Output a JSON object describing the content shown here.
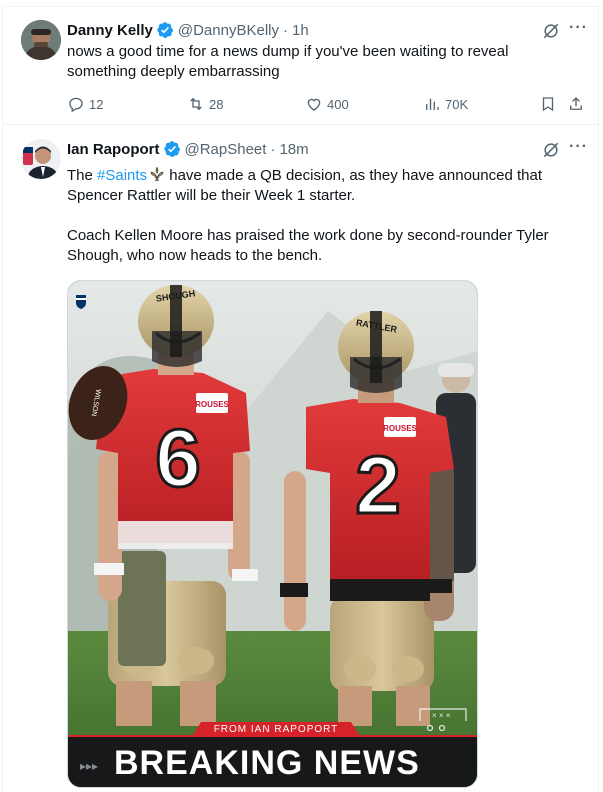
{
  "tweets": [
    {
      "name": "Danny Kelly",
      "handle": "@DannyBKelly",
      "time": "1h",
      "text": "nows a good time for a news dump if you've been waiting to reveal something deeply embarrassing",
      "replies": "12",
      "reposts": "28",
      "likes": "400",
      "views": "70K"
    },
    {
      "name": "Ian Rapoport",
      "handle": "@RapSheet",
      "time": "18m",
      "text_pre": "The ",
      "hashtag": "#Saints",
      "text_post": " have made a QB decision, as they have announced that Spencer Rattler will be their Week 1 starter.",
      "text2": "Coach Kellen Moore has praised the work done by second-rounder Tyler Shough, who now heads to the bench.",
      "media": {
        "helmet_left": "SHOUGH",
        "helmet_right": "RATTLER",
        "jersey_left": "6",
        "jersey_right": "2",
        "sponsor": "ROUSES",
        "ticker_top": "FROM IAN RAPOPORT",
        "ticker_main": "BREAKING NEWS",
        "ticker_arrows": "▸▸▸"
      }
    }
  ],
  "colors": {
    "link": "#1d9bf0",
    "muted": "#536471",
    "verified": "#1d9bf0",
    "breaking_red": "#d6232a"
  }
}
